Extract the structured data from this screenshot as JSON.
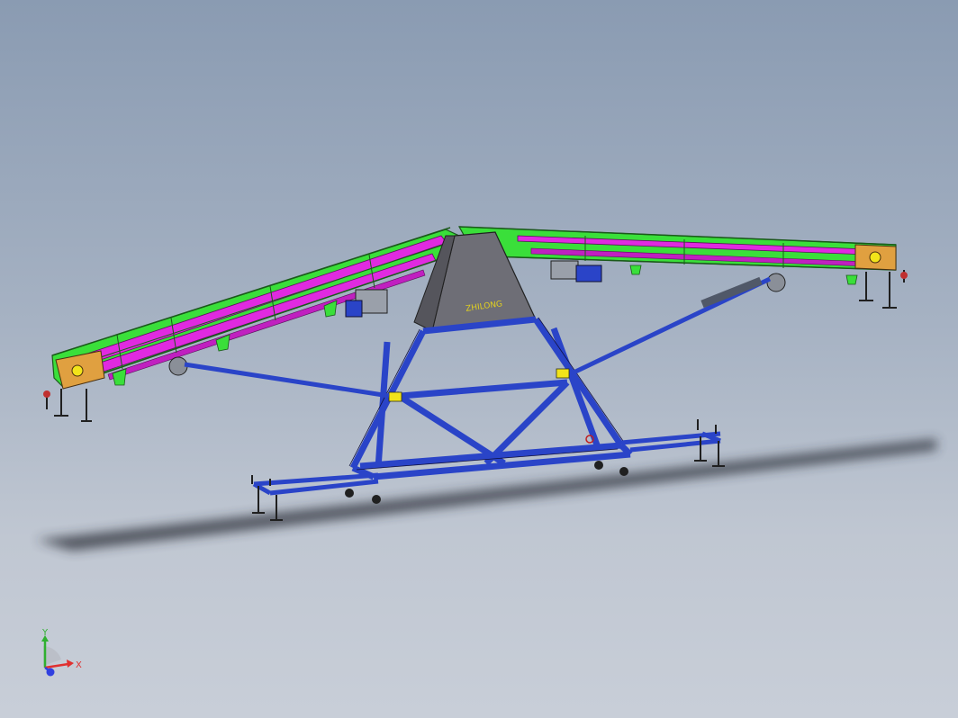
{
  "scene": {
    "background_top": "#8a9bb2",
    "background_bottom": "#c8ced8"
  },
  "model": {
    "plate_text": "ZHILONG",
    "colors": {
      "belt_frame": "#3adf3a",
      "belt_surface": "#e02ae0",
      "tower_frame": "#2a44c8",
      "tower_plate": "#6e6e76",
      "brackets": "#f2e41a",
      "end_plates": "#e0a040",
      "legs": "#202020"
    }
  },
  "triad": {
    "x_label": "X",
    "y_label": "Y",
    "x_color": "#e03030",
    "y_color": "#30b030",
    "z_color": "#3040e0"
  }
}
